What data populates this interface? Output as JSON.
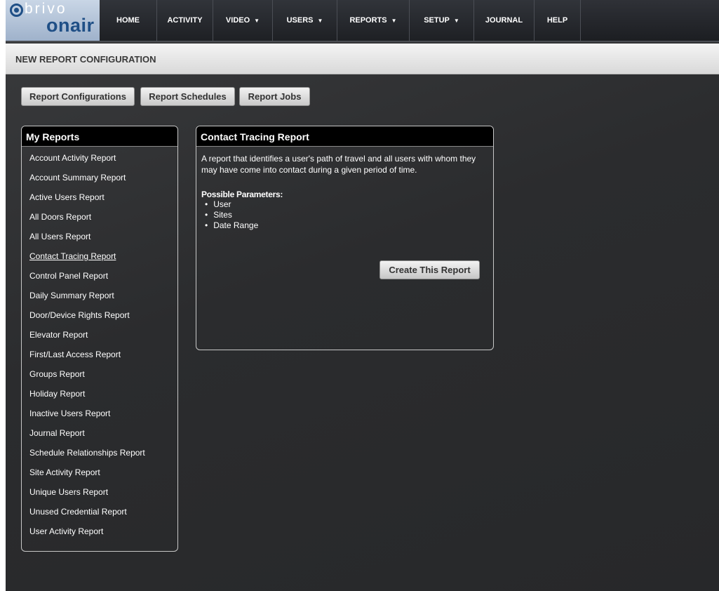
{
  "brand": {
    "top": "brivo",
    "bottom": "onair"
  },
  "nav": {
    "items": [
      {
        "label": "HOME",
        "dropdown": false
      },
      {
        "label": "ACTIVITY",
        "dropdown": false
      },
      {
        "label": "VIDEO",
        "dropdown": true
      },
      {
        "label": "USERS",
        "dropdown": true
      },
      {
        "label": "REPORTS",
        "dropdown": true
      },
      {
        "label": "SETUP",
        "dropdown": true
      },
      {
        "label": "JOURNAL",
        "dropdown": false
      },
      {
        "label": "HELP",
        "dropdown": false
      }
    ]
  },
  "page": {
    "title": "NEW REPORT CONFIGURATION"
  },
  "tabs": [
    "Report Configurations",
    "Report Schedules",
    "Report Jobs"
  ],
  "my_reports": {
    "heading": "My Reports",
    "selected_index": 5,
    "items": [
      "Account Activity Report",
      "Account Summary Report",
      "Active Users Report",
      "All Doors Report",
      "All Users Report",
      "Contact Tracing Report",
      "Control Panel Report",
      "Daily Summary Report",
      "Door/Device Rights Report",
      "Elevator Report",
      "First/Last Access Report",
      "Groups Report",
      "Holiday Report",
      "Inactive Users Report",
      "Journal Report",
      "Schedule Relationships Report",
      "Site Activity Report",
      "Unique Users Report",
      "Unused Credential Report",
      "User Activity Report"
    ]
  },
  "detail": {
    "title": "Contact Tracing Report",
    "description": "A report that identifies a user's path of travel and all users with whom they may have come into contact during a given period of time.",
    "params_heading": "Possible Parameters:",
    "params": [
      "User",
      "Sites",
      "Date Range"
    ],
    "create_label": "Create This Report"
  },
  "colors": {
    "brand_blue": "#1f4f86",
    "panel_header": "#000000",
    "background": "#2b2c2e"
  }
}
